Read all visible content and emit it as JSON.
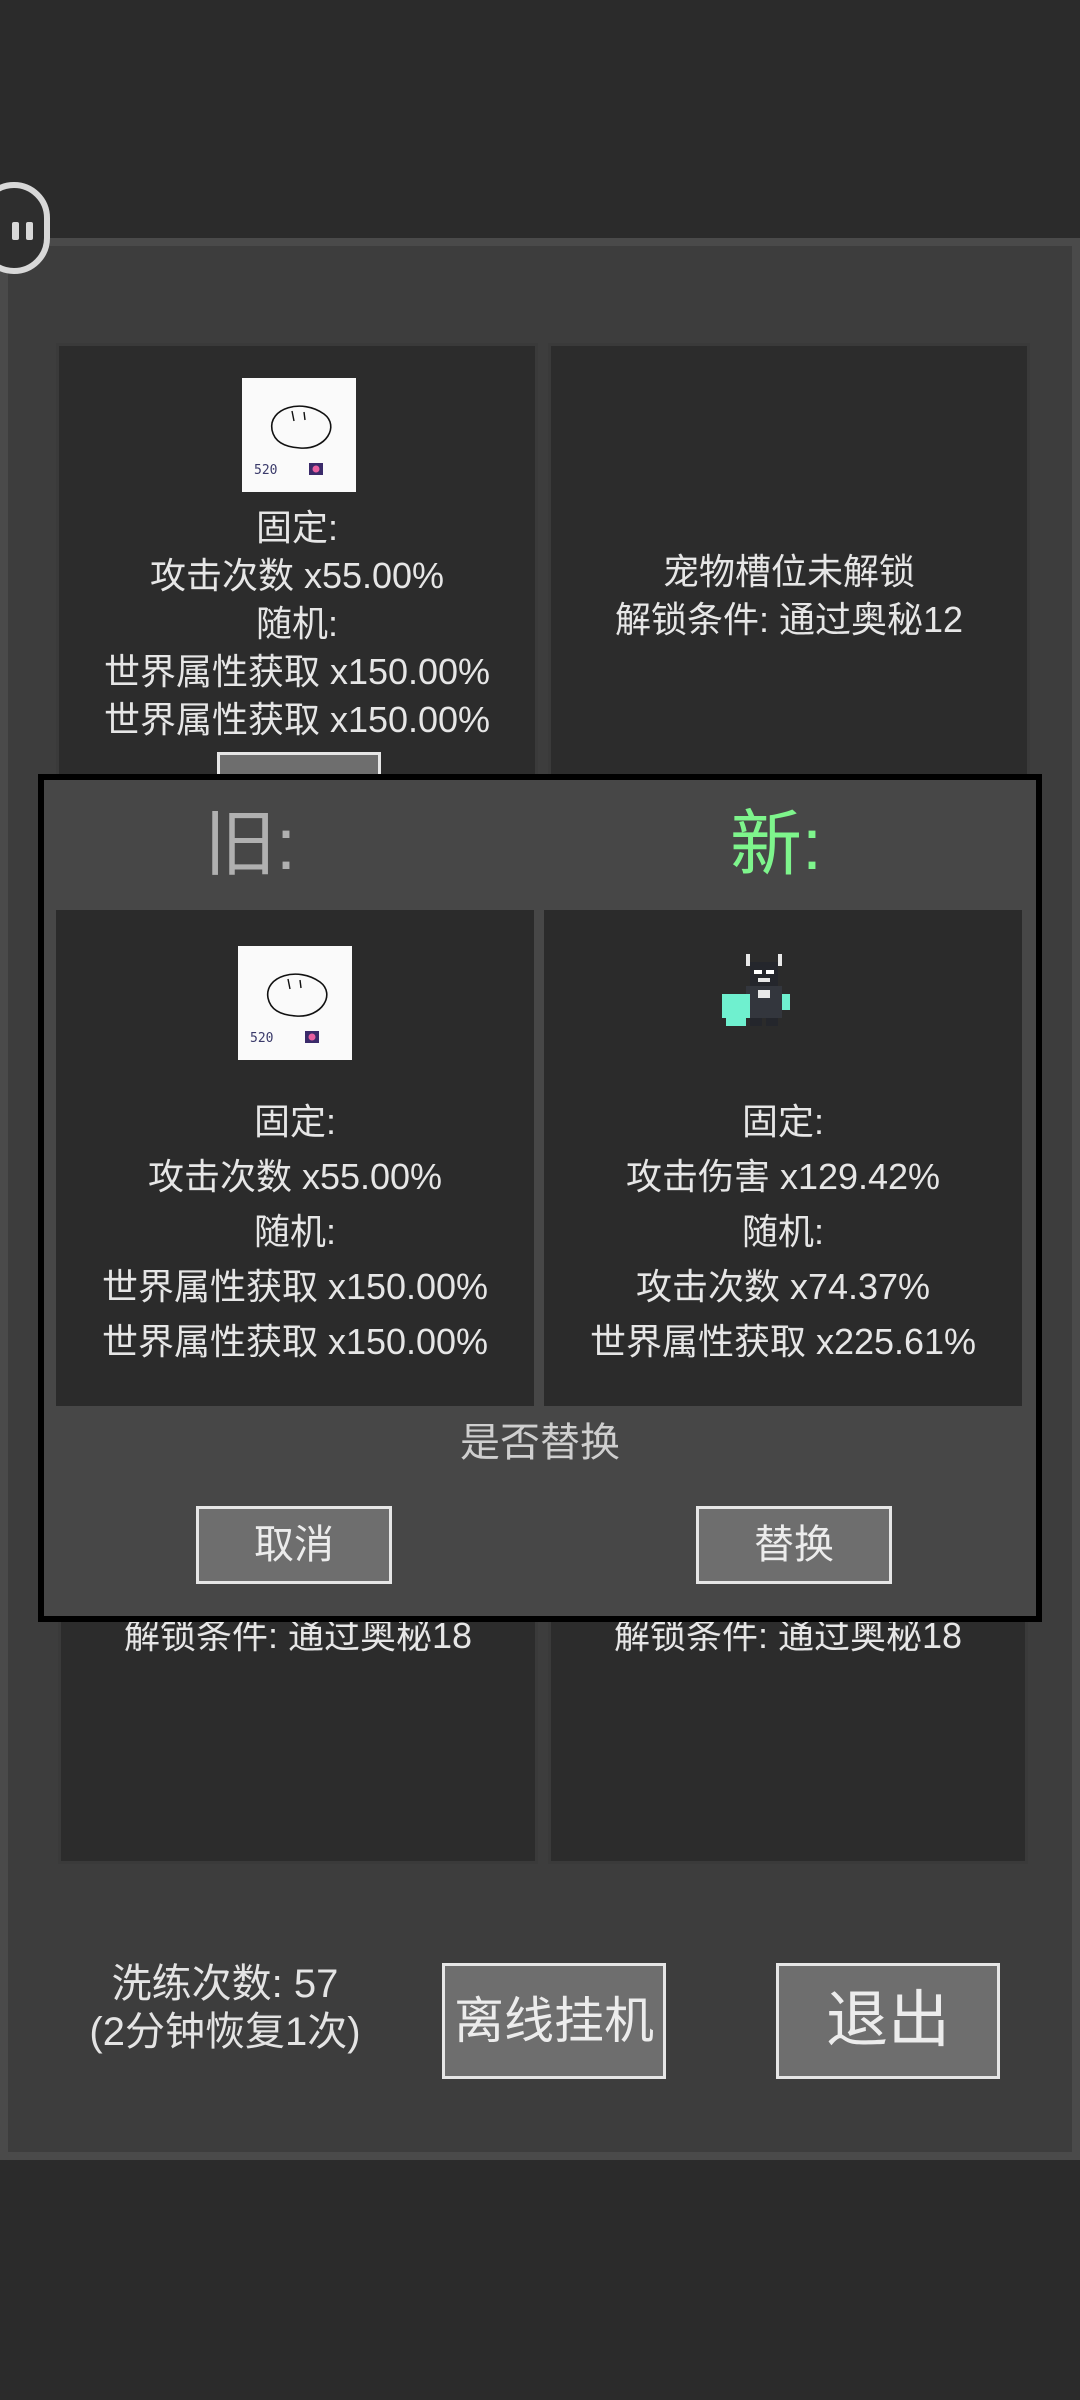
{
  "slots": {
    "slot1": {
      "fixed_label": "固定:",
      "fixed_1": "攻击次数 x55.00%",
      "random_label": "随机:",
      "random_1": "世界属性获取 x150.00%",
      "random_2": "世界属性获取 x150.00%"
    },
    "slot2": {
      "locked": "宠物槽位未解锁",
      "condition": "解锁条件: 通过奥秘12"
    },
    "slot3": {
      "condition": "解锁条件: 通过奥秘18"
    },
    "slot4": {
      "condition": "解锁条件: 通过奥秘18"
    }
  },
  "footer": {
    "refine_count": "洗练次数:  57",
    "refine_recover": "(2分钟恢复1次)",
    "offline_label": "离线挂机",
    "exit_label": "退出"
  },
  "modal": {
    "old_title": "旧:",
    "new_title": "新:",
    "old": {
      "fixed_label": "固定:",
      "fixed_1": "攻击次数 x55.00%",
      "random_label": "随机:",
      "random_1": "世界属性获取 x150.00%",
      "random_2": "世界属性获取 x150.00%"
    },
    "new": {
      "fixed_label": "固定:",
      "fixed_1": "攻击伤害 x129.42%",
      "random_label": "随机:",
      "random_1": "攻击次数 x74.37%",
      "random_2": "世界属性获取 x225.61%"
    },
    "question": "是否替换",
    "cancel_label": "取消",
    "replace_label": "替换"
  },
  "pet_sketch_caption": "520",
  "colors": {
    "new_title": "#7ef58c",
    "old_title": "#b0b0b0",
    "pet_accent": "#6ff0cf"
  }
}
